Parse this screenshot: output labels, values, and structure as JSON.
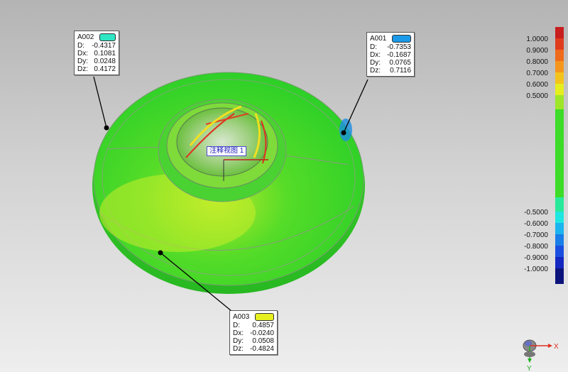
{
  "annotation_view": {
    "label": "注释视图 1"
  },
  "callouts": [
    {
      "id": "A002",
      "color": "#2ee6c4",
      "rows": [
        {
          "k": "D:",
          "v": "-0.4317"
        },
        {
          "k": "Dx:",
          "v": "0.1081"
        },
        {
          "k": "Dy:",
          "v": "0.0248"
        },
        {
          "k": "Dz:",
          "v": "0.4172"
        }
      ]
    },
    {
      "id": "A001",
      "color": "#1a9ae8",
      "rows": [
        {
          "k": "D:",
          "v": "-0.7353"
        },
        {
          "k": "Dx:",
          "v": "-0.1687"
        },
        {
          "k": "Dy:",
          "v": "0.0765"
        },
        {
          "k": "Dz:",
          "v": "0.7116"
        }
      ]
    },
    {
      "id": "A003",
      "color": "#e6f01e",
      "rows": [
        {
          "k": "D:",
          "v": "0.4857"
        },
        {
          "k": "Dx:",
          "v": "-0.0240"
        },
        {
          "k": "Dy:",
          "v": "0.0508"
        },
        {
          "k": "Dz:",
          "v": "-0.4824"
        }
      ]
    }
  ],
  "legend": {
    "ticks_top": [
      "1.0000",
      "0.9000",
      "0.8000",
      "0.7000",
      "0.6000",
      "0.5000"
    ],
    "ticks_bottom": [
      "-0.5000",
      "-0.6000",
      "-0.7000",
      "-0.8000",
      "-0.9000",
      "-1.0000"
    ]
  },
  "triad": {
    "x_label": "X",
    "y_label": "Y",
    "icon": "view-triad-icon"
  }
}
